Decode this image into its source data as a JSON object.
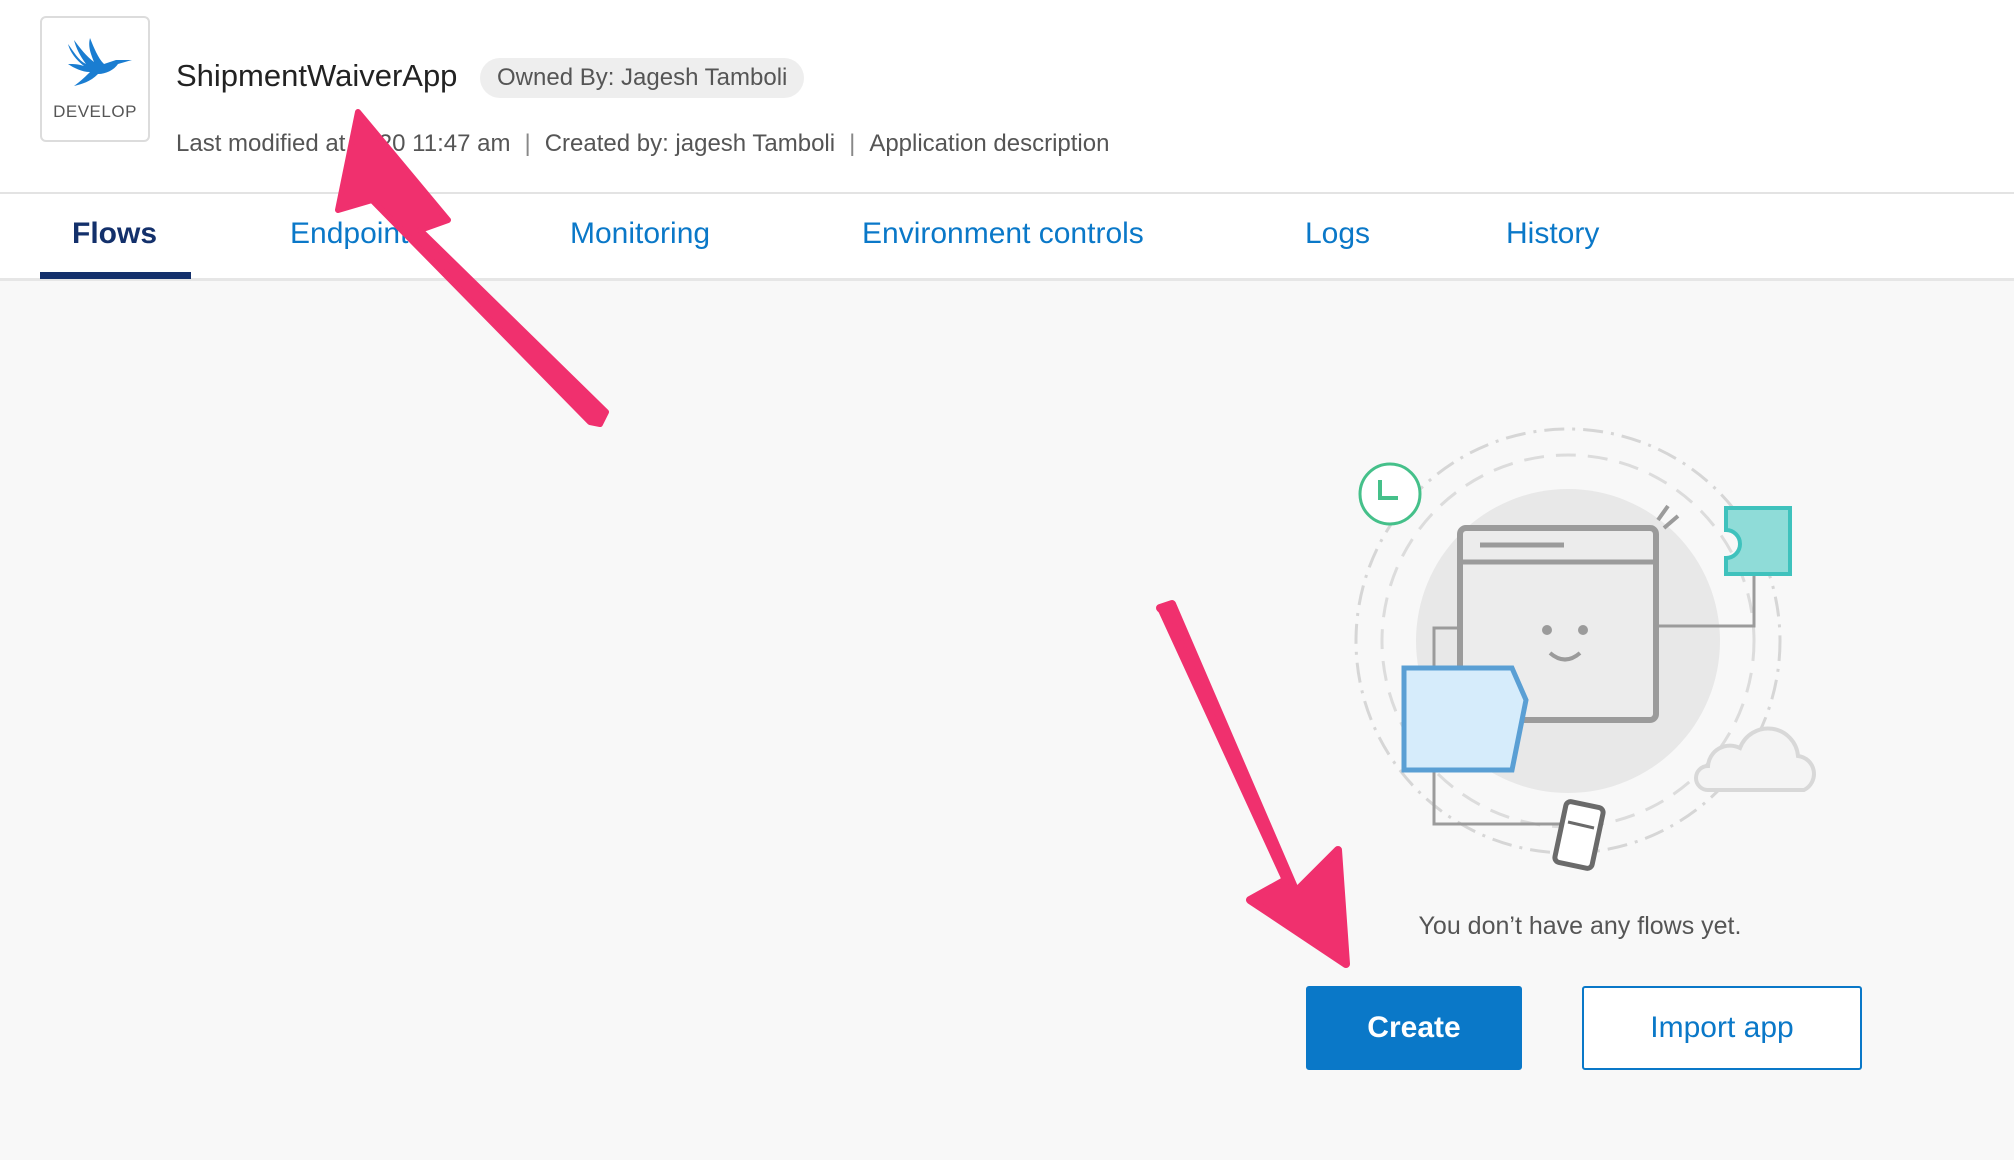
{
  "app": {
    "environment_label": "DEVELOP",
    "name": "ShipmentWaiverApp",
    "owner_badge": "Owned By: Jagesh Tamboli",
    "meta": {
      "last_modified": "Last modified at 2020 11:47 am",
      "separator": "|",
      "created_by": "Created by: jagesh Tamboli",
      "description": "Application description"
    }
  },
  "tabs": [
    {
      "label": "Flows",
      "active": true
    },
    {
      "label": "Endpoints",
      "active": false
    },
    {
      "label": "Monitoring",
      "active": false
    },
    {
      "label": "Environment controls",
      "active": false
    },
    {
      "label": "Logs",
      "active": false
    },
    {
      "label": "History",
      "active": false
    }
  ],
  "empty_state": {
    "message": "You don’t have any flows yet.",
    "create_label": "Create",
    "import_label": "Import app"
  },
  "colors": {
    "accent": "#0a78c8",
    "active_tab": "#13306b",
    "annotation_arrow": "#f0306e"
  },
  "icons": [
    "hummingbird-logo-icon",
    "clock-icon",
    "puzzle-piece-icon",
    "browser-window-icon",
    "cloud-icon",
    "phone-icon",
    "annotation-arrow-icon"
  ]
}
